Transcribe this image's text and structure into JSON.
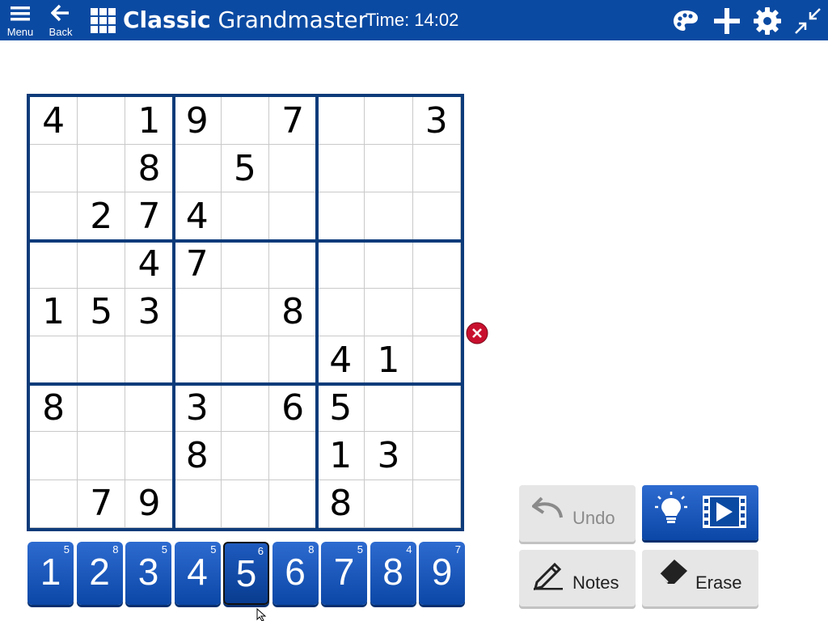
{
  "topbar": {
    "menu_label": "Menu",
    "back_label": "Back",
    "title_bold": "Classic",
    "title_rest": " Grandmaster",
    "timer": "Time: 14:02",
    "icons": [
      "menu-icon",
      "back-arrow-icon",
      "grid-logo-icon",
      "palette-icon",
      "plus-icon",
      "gear-icon",
      "collapse-icon"
    ]
  },
  "board": {
    "rows": [
      [
        "4",
        "",
        "1",
        "9",
        "",
        "7",
        "",
        "",
        "3"
      ],
      [
        "",
        "",
        "8",
        "",
        "5",
        "",
        "",
        "",
        ""
      ],
      [
        "",
        "2",
        "7",
        "4",
        "",
        "",
        "",
        "",
        ""
      ],
      [
        "",
        "",
        "4",
        "7",
        "",
        "",
        "",
        "",
        ""
      ],
      [
        "1",
        "5",
        "3",
        "",
        "",
        "8",
        "",
        "",
        ""
      ],
      [
        "",
        "",
        "",
        "",
        "",
        "",
        "4",
        "1",
        ""
      ],
      [
        "8",
        "",
        "",
        "3",
        "",
        "6",
        "5",
        "",
        ""
      ],
      [
        "",
        "",
        "",
        "8",
        "",
        "",
        "1",
        "3",
        ""
      ],
      [
        "",
        "7",
        "9",
        "",
        "",
        "",
        "8",
        "",
        ""
      ]
    ]
  },
  "error_icon": "close-circle-icon",
  "number_keys": [
    {
      "digit": "1",
      "count": "5"
    },
    {
      "digit": "2",
      "count": "8"
    },
    {
      "digit": "3",
      "count": "5"
    },
    {
      "digit": "4",
      "count": "5"
    },
    {
      "digit": "5",
      "count": "6"
    },
    {
      "digit": "6",
      "count": "8"
    },
    {
      "digit": "7",
      "count": "5"
    },
    {
      "digit": "8",
      "count": "4"
    },
    {
      "digit": "9",
      "count": "7"
    }
  ],
  "selected_number": "5",
  "actions": {
    "undo_label": "Undo",
    "notes_label": "Notes",
    "erase_label": "Erase",
    "hint_icons": [
      "lightbulb-icon",
      "video-icon"
    ]
  },
  "colors": {
    "accent": "#0b4aa2",
    "board_line": "#0d3b7a",
    "error": "#c8102e"
  }
}
